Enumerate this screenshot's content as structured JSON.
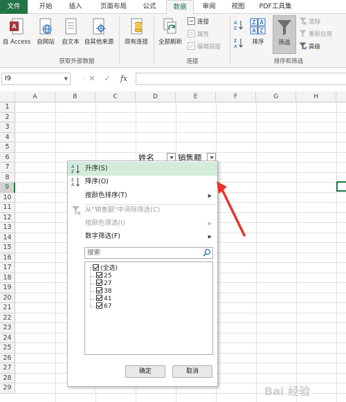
{
  "tabs": [
    "文件",
    "开始",
    "插入",
    "页面布局",
    "公式",
    "数据",
    "审阅",
    "视图",
    "PDF工具集"
  ],
  "ribbon": {
    "get_external": {
      "label": "获取外部数据",
      "access": "自 Access",
      "web": "自网站",
      "text": "自文本",
      "other": "自其他来源",
      "existing": "现有连接"
    },
    "connections": {
      "label": "连接",
      "refresh_all": "全部刷新",
      "connections": "连接",
      "properties": "属性",
      "edit_links": "编辑链接"
    },
    "sort_filter": {
      "label": "排序和筛选",
      "sort": "排序",
      "filter": "筛选",
      "clear": "清除",
      "reapply": "重新应用",
      "advanced": "高级"
    }
  },
  "formula_bar": {
    "name_box": "I9",
    "fx": "fx",
    "cancel": "✕",
    "enter": "✓",
    "value": ""
  },
  "columns": [
    "A",
    "B",
    "C",
    "D",
    "E",
    "F",
    "G",
    "H"
  ],
  "rows": [
    "1",
    "2",
    "3",
    "4",
    "5",
    "6",
    "7",
    "8",
    "9",
    "10",
    "11",
    "12",
    "13",
    "14",
    "15",
    "16",
    "17",
    "18",
    "19",
    "20",
    "21",
    "22",
    "23",
    "24",
    "25",
    "26",
    "27",
    "28",
    "29"
  ],
  "cells": {
    "d6": "姓名",
    "e6": "销售额"
  },
  "filter_menu": {
    "sort_asc": "升序(S)",
    "sort_desc": "降序(O)",
    "sort_by_color": "按颜色排序(T)",
    "clear_filter": "从\"销售额\"中清除筛选(C)",
    "filter_by_color": "按颜色筛选(I)",
    "number_filters": "数字筛选(F)",
    "search_placeholder": "搜索",
    "values": [
      "(全选)",
      "25",
      "27",
      "38",
      "41",
      "67"
    ],
    "ok": "确定",
    "cancel": "取消"
  },
  "watermark": "Bai 经验",
  "colors": {
    "accent": "#217346",
    "highlight": "#d3ecd9",
    "arrow": "#e8302a"
  }
}
